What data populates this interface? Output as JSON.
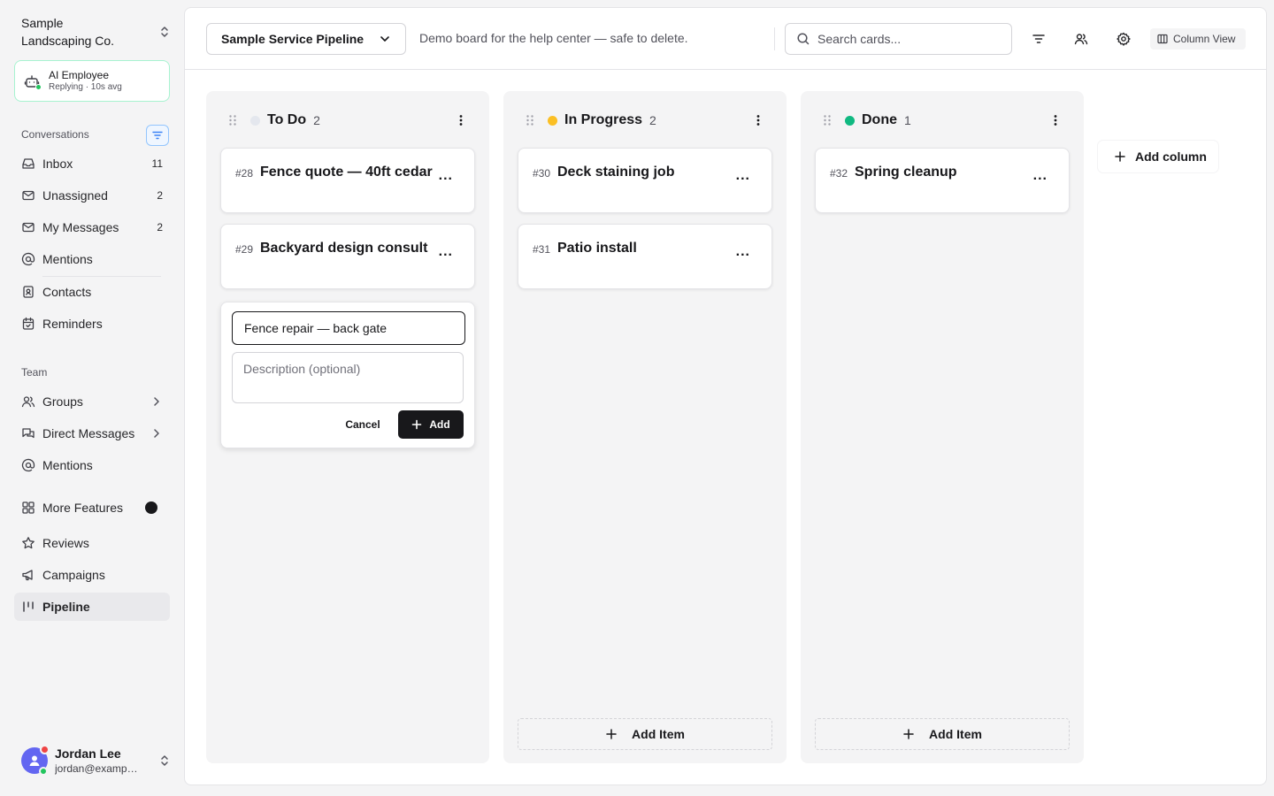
{
  "org": {
    "name": "Sample Landscaping Co."
  },
  "ai_employee": {
    "title": "AI Employee",
    "status": "Replying · 10s avg"
  },
  "sidebar": {
    "conversations_label": "Conversations",
    "conversations": [
      {
        "label": "Inbox",
        "count": "11",
        "icon": "inbox-icon"
      },
      {
        "label": "Unassigned",
        "count": "2",
        "icon": "mail-unassigned-icon"
      },
      {
        "label": "My Messages",
        "count": "2",
        "icon": "mail-icon"
      },
      {
        "label": "Mentions",
        "count": "",
        "icon": "at-sign-icon"
      },
      {
        "label": "Contacts",
        "count": "",
        "icon": "contact-book-icon"
      },
      {
        "label": "Reminders",
        "count": "",
        "icon": "calendar-check-icon"
      }
    ],
    "team_label": "Team",
    "team": [
      {
        "label": "Groups",
        "icon": "users-icon"
      },
      {
        "label": "Direct Messages",
        "icon": "chat-icon"
      },
      {
        "label": "Mentions",
        "icon": "at-sign-icon"
      }
    ],
    "more_features": "More Features",
    "reviews": "Reviews",
    "campaigns": "Campaigns",
    "pipeline": "Pipeline"
  },
  "user": {
    "name": "Jordan Lee",
    "email": "jordan@example.com"
  },
  "topbar": {
    "pipeline_name": "Sample Service Pipeline",
    "description": "Demo board for the help center — safe to delete.",
    "search_placeholder": "Search cards...",
    "column_view": "Column View"
  },
  "columns": [
    {
      "title": "To Do",
      "count": "2",
      "color": "#e4e7ee",
      "cards": [
        {
          "num": "#28",
          "title": "Fence quote — 40ft cedar"
        },
        {
          "num": "#29",
          "title": "Backyard design consult"
        }
      ]
    },
    {
      "title": "In Progress",
      "count": "2",
      "color": "#fbbf24",
      "cards": [
        {
          "num": "#30",
          "title": "Deck staining job"
        },
        {
          "num": "#31",
          "title": "Patio install"
        }
      ]
    },
    {
      "title": "Done",
      "count": "1",
      "color": "#10b981",
      "cards": [
        {
          "num": "#32",
          "title": "Spring cleanup"
        }
      ]
    }
  ],
  "new_card": {
    "title_value": "Fence repair — back gate",
    "description_placeholder": "Description (optional)",
    "cancel": "Cancel",
    "add": "Add"
  },
  "add_item": "Add Item",
  "add_column": "Add column",
  "more_glyph": "..."
}
